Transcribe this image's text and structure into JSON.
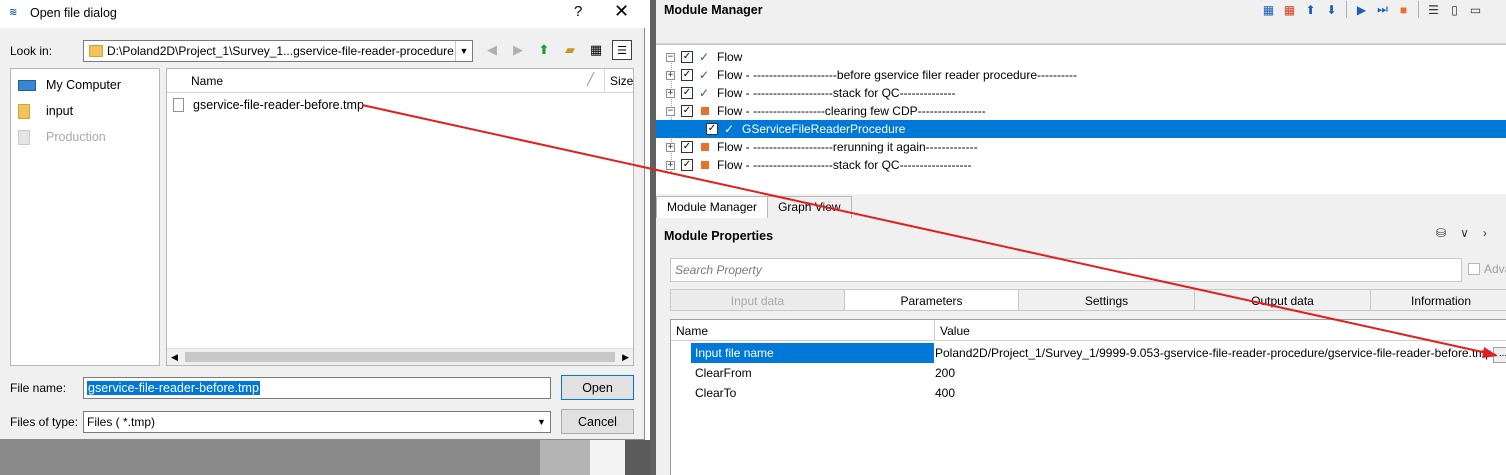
{
  "module_manager": {
    "title": "Module Manager",
    "tree": [
      {
        "label": "Flow",
        "checked": true,
        "status": "ok",
        "level": 0,
        "expander": "minus"
      },
      {
        "label": "Flow - ---------------------before gservice filer reader procedure----------",
        "checked": true,
        "status": "ok",
        "level": 1,
        "expander": "plus"
      },
      {
        "label": "Flow - --------------------stack for QC--------------",
        "checked": true,
        "status": "ok",
        "level": 1,
        "expander": "plus"
      },
      {
        "label": "Flow - ------------------clearing few CDP-----------------",
        "checked": true,
        "status": "warn",
        "level": 1,
        "expander": "minus"
      },
      {
        "label": "GServiceFileReaderProcedure",
        "checked": true,
        "status": "ok",
        "level": 2,
        "expander": "",
        "selected": true
      },
      {
        "label": "Flow - --------------------rerunning it again-------------",
        "checked": true,
        "status": "warn",
        "level": 1,
        "expander": "plus"
      },
      {
        "label": "Flow - --------------------stack for QC------------------",
        "checked": true,
        "status": "warn",
        "level": 1,
        "expander": "plus"
      }
    ],
    "bottom_tabs": [
      "Module Manager",
      "Graph View"
    ],
    "toolbar_icons": [
      "add-module-icon",
      "remove-module-icon",
      "move-up-icon",
      "move-down-icon",
      "run-icon",
      "run-step-icon",
      "stop-icon",
      "log-icon",
      "clipboard-icon",
      "window-icon"
    ]
  },
  "module_properties": {
    "title": "Module Properties",
    "search_placeholder": "Search Property",
    "advanced_label": "Adva",
    "tabs": [
      {
        "label": "Input data",
        "state": "disabled"
      },
      {
        "label": "Parameters",
        "state": "active"
      },
      {
        "label": "Settings",
        "state": "normal"
      },
      {
        "label": "Output data",
        "state": "normal"
      },
      {
        "label": "Information",
        "state": "normal"
      }
    ],
    "table": {
      "headers": [
        "Name",
        "Value"
      ],
      "rows": [
        {
          "name": "Input file name",
          "value": "Poland2D/Project_1/Survey_1/9999-9.053-gservice-file-reader-procedure/gservice-file-reader-before.tmp",
          "selected": true
        },
        {
          "name": "ClearFrom",
          "value": "200"
        },
        {
          "name": "ClearTo",
          "value": "400"
        }
      ],
      "browse_label": "..."
    }
  },
  "dialog": {
    "title": "Open file dialog",
    "help": "?",
    "close": "✕",
    "look_in_label": "Look in:",
    "look_in_value": "D:\\Poland2D\\Project_1\\Survey_1...gservice-file-reader-procedure",
    "places": [
      {
        "label": "My Computer",
        "icon": "computer-icon",
        "enabled": true
      },
      {
        "label": "input",
        "icon": "folder-icon",
        "enabled": true
      },
      {
        "label": "Production",
        "icon": "folder-icon",
        "enabled": false
      }
    ],
    "file_columns": [
      "Name",
      "Size"
    ],
    "files": [
      "gservice-file-reader-before.tmp"
    ],
    "file_name_label": "File name:",
    "file_name_value": "gservice-file-reader-before.tmp",
    "open_label": "Open",
    "files_of_type_label": "Files of type:",
    "files_of_type_value": "Files ( *.tmp)",
    "cancel_label": "Cancel"
  },
  "annotation": {
    "color": "#e02020"
  }
}
